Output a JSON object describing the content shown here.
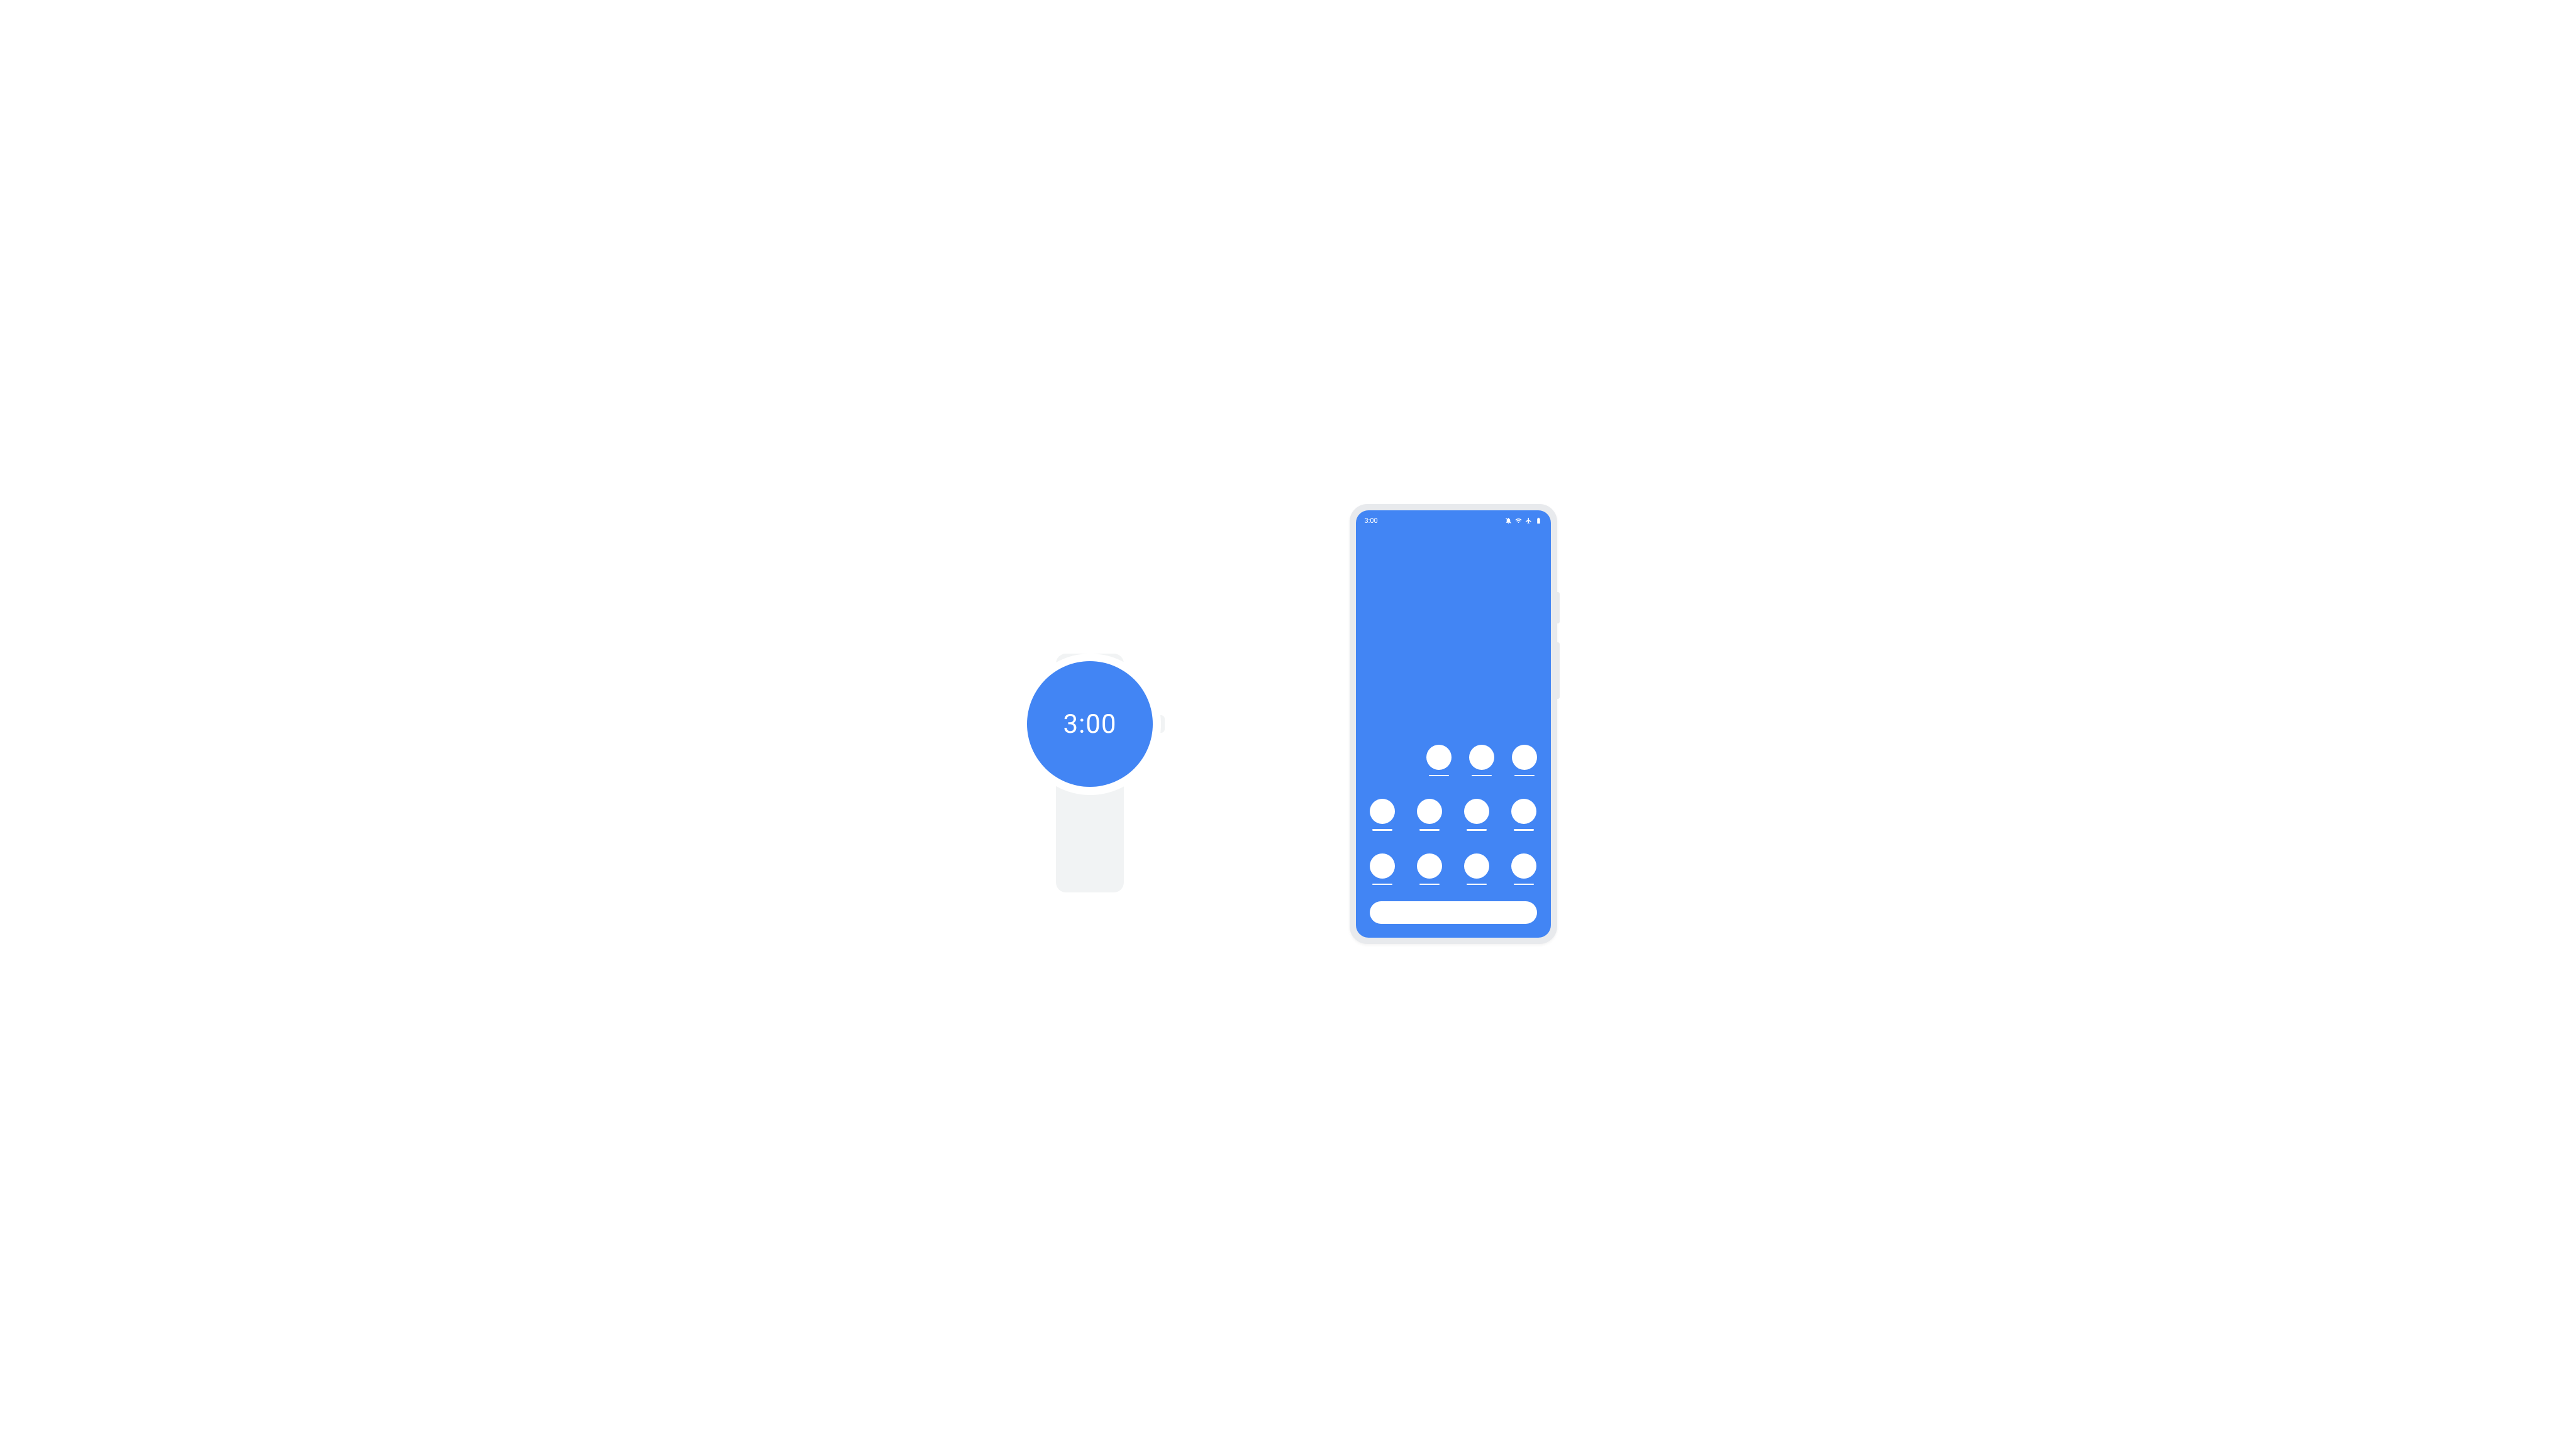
{
  "watch": {
    "time": "3:00"
  },
  "phone": {
    "status_bar": {
      "time": "3:00"
    },
    "app_rows": [
      {
        "align": "right",
        "count": 3
      },
      {
        "align": "full",
        "count": 4
      },
      {
        "align": "full",
        "count": 4
      }
    ]
  },
  "colors": {
    "accent": "#4285f4",
    "device_frame": "#e8eaed",
    "strap": "#f1f3f4",
    "foreground": "#ffffff"
  }
}
